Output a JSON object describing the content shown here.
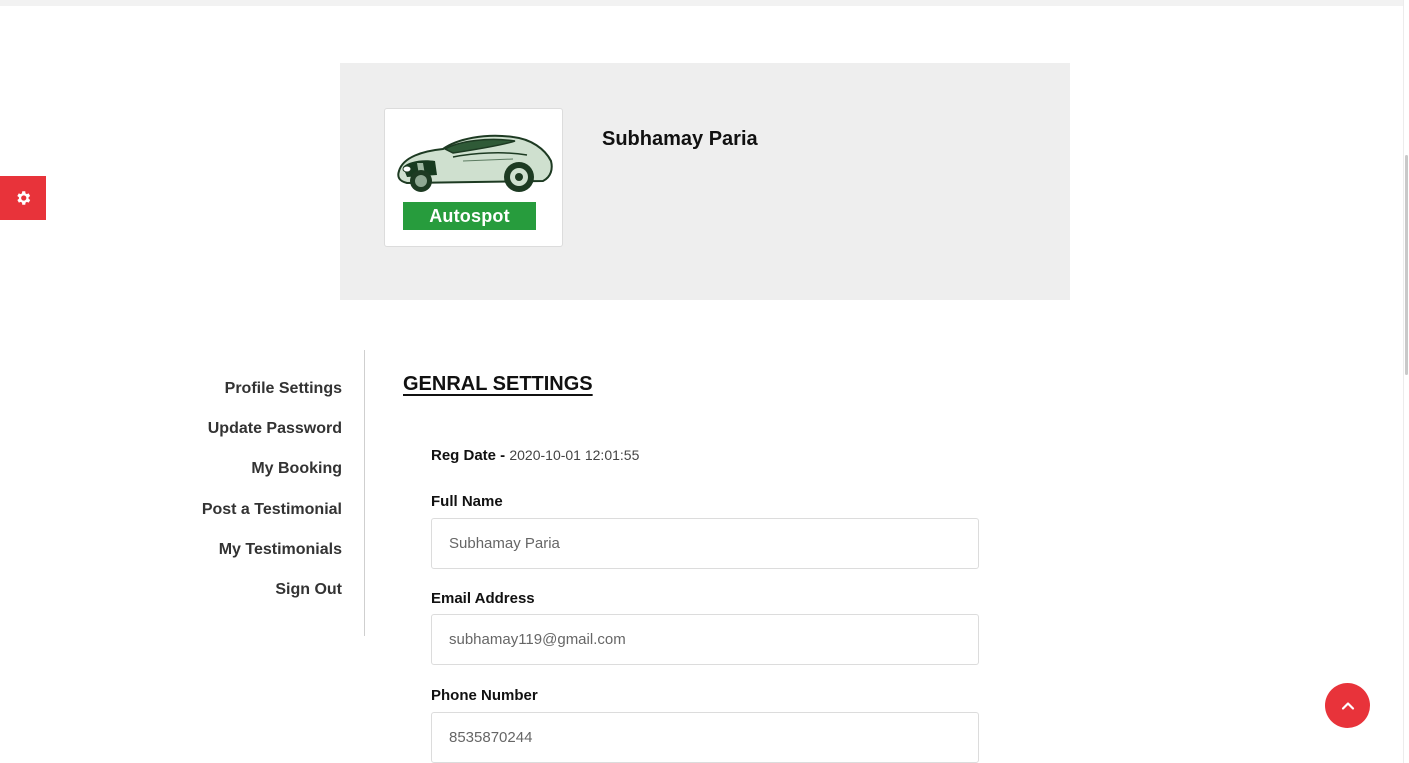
{
  "profile": {
    "name": "Subhamay Paria",
    "brand": "Autospot"
  },
  "nav": {
    "items": [
      {
        "label": "Profile Settings"
      },
      {
        "label": "Update Password"
      },
      {
        "label": "My Booking"
      },
      {
        "label": "Post a Testimonial"
      },
      {
        "label": "My Testimonials"
      },
      {
        "label": "Sign Out"
      }
    ]
  },
  "settings": {
    "title": "GENRAL SETTINGS",
    "reg_date_label": "Reg Date -",
    "reg_date_value": "2020-10-01 12:01:55",
    "full_name_label": "Full Name",
    "full_name_value": "Subhamay Paria",
    "email_label": "Email Address",
    "email_value": "subhamay119@gmail.com",
    "phone_label": "Phone Number",
    "phone_value": "8535870244"
  },
  "icons": {
    "settings": "gear-icon",
    "scroll_top": "chevron-up-icon",
    "avatar": "car-logo"
  },
  "colors": {
    "accent": "#e8333a",
    "brand_badge": "#279c3d",
    "banner_bg": "#eeeeee"
  }
}
